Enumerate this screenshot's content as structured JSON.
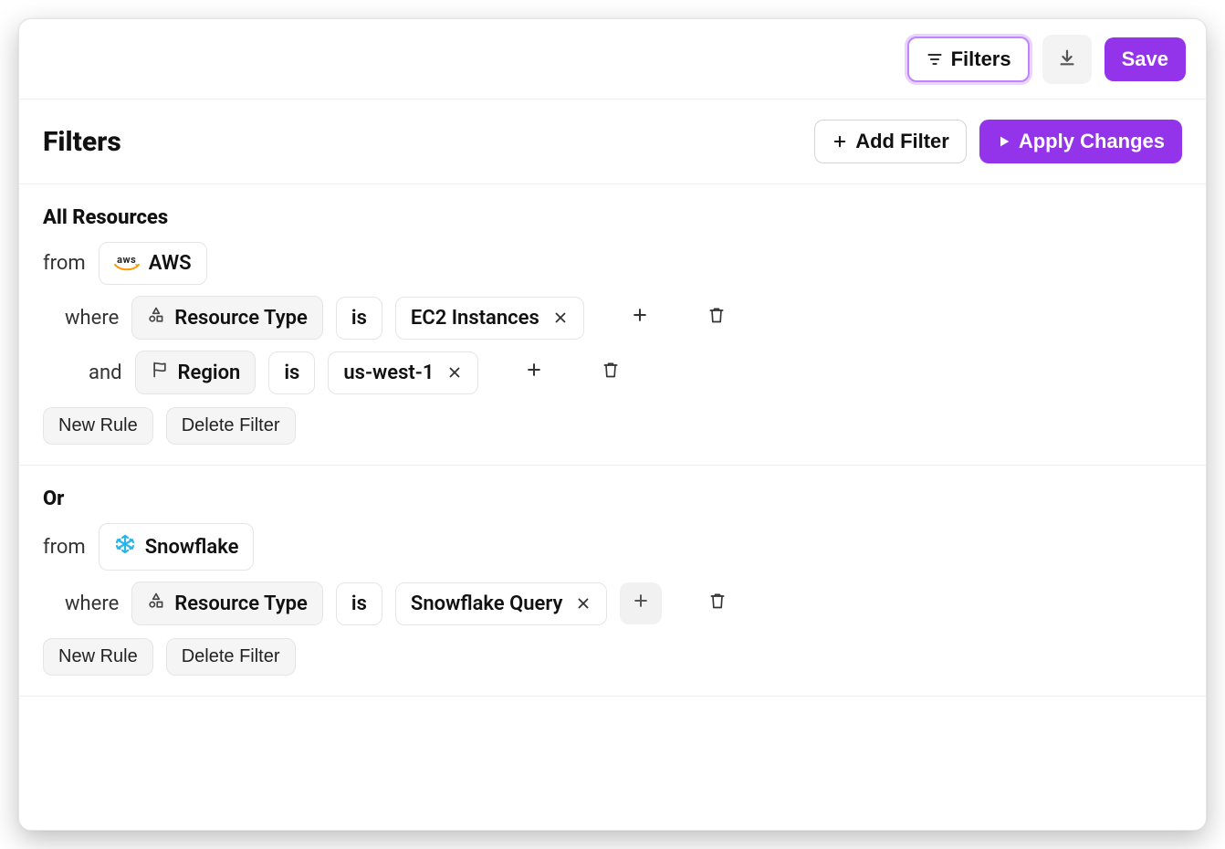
{
  "topbar": {
    "filters_label": "Filters",
    "save_label": "Save"
  },
  "section": {
    "title": "Filters",
    "add_filter_label": "Add Filter",
    "apply_changes_label": "Apply Changes"
  },
  "common": {
    "from": "from",
    "where": "where",
    "and": "and",
    "is": "is",
    "new_rule": "New Rule",
    "delete_filter": "Delete Filter"
  },
  "groups": [
    {
      "title": "All Resources",
      "provider": "AWS",
      "rules": [
        {
          "field": "Resource Type",
          "op": "is",
          "value": "EC2 Instances",
          "add_hover": false
        },
        {
          "field": "Region",
          "op": "is",
          "value": "us-west-1",
          "add_hover": false
        }
      ]
    },
    {
      "title": "Or",
      "provider": "Snowflake",
      "rules": [
        {
          "field": "Resource Type",
          "op": "is",
          "value": "Snowflake Query",
          "add_hover": true
        }
      ]
    }
  ]
}
